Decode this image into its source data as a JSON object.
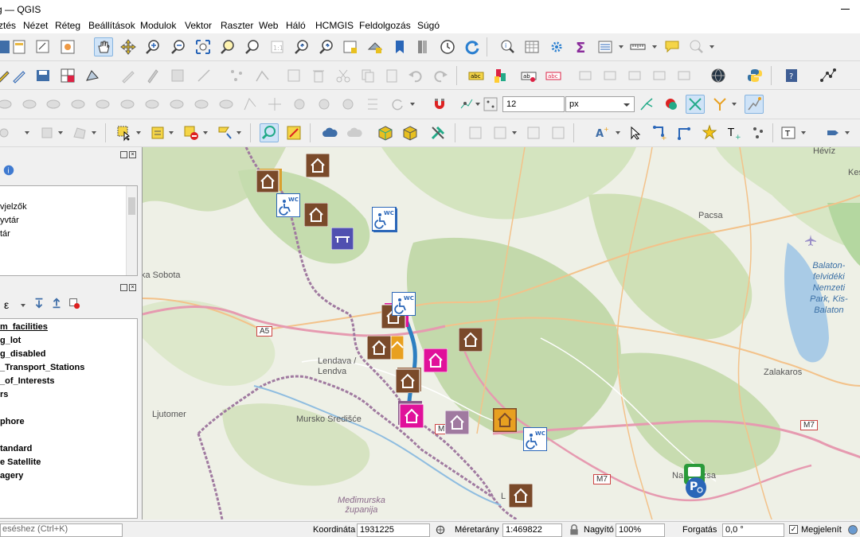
{
  "window": {
    "title": "g — QGIS"
  },
  "menu": {
    "items": [
      "ztés",
      "Nézet",
      "Réteg",
      "Beállítások",
      "Modulok",
      "Vektor",
      "Raszter",
      "Web",
      "Háló",
      "HCMGIS",
      "Feldolgozás",
      "Súgó"
    ]
  },
  "toolbar": {
    "snap_size": "12",
    "snap_unit": "px"
  },
  "browser_panel": {
    "items": [
      "vjelzők",
      "yvtár",
      "tár"
    ]
  },
  "layers_panel": {
    "filter_label": "ε",
    "layers": [
      "m_facilities",
      "g_lot",
      "g_disabled",
      "_Transport_Stations",
      "_of_Interests",
      "rs",
      "",
      "phore",
      "",
      "tandard",
      "e Satellite",
      "agery"
    ]
  },
  "map": {
    "labels": {
      "sobota": "ka Sobota",
      "pacsa": "Pacsa",
      "lendava": "Lendava /\nLendva",
      "mursko": "Mursko Središće",
      "ljutomer": "Ljutomer",
      "zalakaros": "Zalakaros",
      "heviz": "Hévíz",
      "keszthely": "Kes",
      "balaton": "Balaton-\nfelvidéki\nNemzeti\nPark, Kis-\nBalaton",
      "medimurska": "Međimurska\nžupanija",
      "nagykanizsa": "Na     hizsa",
      "letenye": "L        e"
    },
    "roads": {
      "a5": "A5",
      "m7a": "M7",
      "m7b": "M7",
      "m7c": "M7"
    }
  },
  "status": {
    "locator_placeholder": "eséshez (Ctrl+K)",
    "coordinate_label": "Koordináta",
    "coordinate_value": "1931225  5906916",
    "scale_label": "Méretarány",
    "scale_value": "1:469822",
    "magnifier_label": "Nagyító",
    "magnifier_value": "100%",
    "rotation_label": "Forgatás",
    "rotation_value": "0,0 °",
    "render_label": "Megjelenít"
  },
  "colors": {
    "accent": "#2b6cb0",
    "marker_brown": "#7a4a2a",
    "marker_pink": "#e0119a",
    "marker_orange": "#f0a030",
    "marker_purple": "#5050b0",
    "border_purple": "#8a5a8a",
    "river": "#2d7fc1"
  }
}
